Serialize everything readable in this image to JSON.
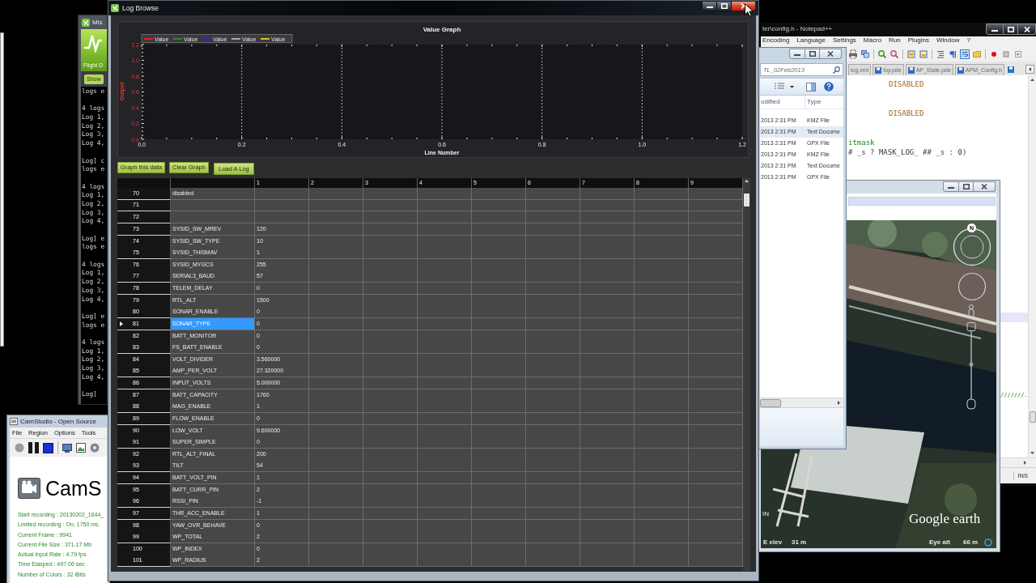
{
  "mission_planner": {
    "title": "Mis",
    "view_label": "Flight D",
    "show_button": "Show",
    "console_blocks": [
      [
        "logs e"
      ],
      [
        "4 logs",
        "Log 1,",
        "Log 2,",
        "Log 3,",
        "Log 4,"
      ],
      [
        "Log] c",
        "logs e"
      ],
      [
        "4 logs",
        "Log 1,",
        "Log 2,",
        "Log 3,",
        "Log 4,"
      ],
      [
        "Log] e",
        "logs e"
      ],
      [
        "4 logs",
        "Log 1,",
        "Log 2,",
        "Log 3,",
        "Log 4,"
      ],
      [
        "Log] e",
        "logs e"
      ],
      [
        "4 logs",
        "Log 1,",
        "Log 2,",
        "Log 3,",
        "Log 4,"
      ],
      [
        "Log]"
      ]
    ]
  },
  "camstudio": {
    "title": "CamStudio - Open Source",
    "menu": [
      "File",
      "Region",
      "Options",
      "Tools"
    ],
    "app_name": "CamS",
    "stats": [
      "Start recording : 20130202_1644_",
      "Limited recording : On, 1750 ms.",
      "Current Frame : 9941",
      "Current File Size : 371.17 Mb",
      "Actual Input Rate : 4.79 fps",
      "Time Elasped : 497.06 sec",
      "Number of Colors : 32 iBits"
    ]
  },
  "log_browse": {
    "title": "Log Browse",
    "graph": {
      "title": "Value Graph",
      "legend": [
        {
          "label": "Value",
          "color": "#e02424"
        },
        {
          "label": "Value",
          "color": "#2e8b2e"
        },
        {
          "label": "Value",
          "color": "#2424e0"
        },
        {
          "label": "Value",
          "color": "#a8a8a8"
        },
        {
          "label": "Value",
          "color": "#d4c21e"
        }
      ],
      "ylabel": "Output",
      "y_ticks": [
        "1.2",
        "1.0",
        "0.8",
        "0.6",
        "0.4",
        "0.2",
        "0.0"
      ],
      "x_ticks": [
        "0.0",
        "0.2",
        "0.4",
        "0.6",
        "0.8",
        "1.0",
        "1.2"
      ],
      "xlabel": "Line Number"
    },
    "buttons": [
      "Graph this data",
      "Clear Graph",
      "Load A Log"
    ],
    "table": {
      "columns": [
        "1",
        "2",
        "3",
        "4",
        "5",
        "6",
        "7",
        "8",
        "9"
      ],
      "rows": [
        {
          "row_header": "70",
          "column_0": "disabled",
          "selected": false
        },
        {
          "row_header": "71",
          "selected": false
        },
        {
          "row_header": "72",
          "selected": false
        },
        {
          "row_header": "73",
          "column_0": "SYSID_SW_MREV",
          "column_1": "120",
          "selected": false
        },
        {
          "row_header": "74",
          "column_0": "SYSID_SW_TYPE",
          "column_1": "10",
          "selected": false
        },
        {
          "row_header": "75",
          "column_0": "SYSID_THISMAV",
          "column_1": "1",
          "selected": false
        },
        {
          "row_header": "76",
          "column_0": "SYSID_MYGCS",
          "column_1": "255",
          "selected": false
        },
        {
          "row_header": "77",
          "column_0": "SERIAL3_BAUD",
          "column_1": "57",
          "selected": false
        },
        {
          "row_header": "78",
          "column_0": "TELEM_DELAY",
          "column_1": "0",
          "selected": false
        },
        {
          "row_header": "79",
          "column_0": "RTL_ALT",
          "column_1": "1500",
          "selected": false
        },
        {
          "row_header": "80",
          "column_0": "SONAR_ENABLE",
          "column_1": "0",
          "selected": false
        },
        {
          "row_header": "81",
          "column_0": "SONAR_TYPE",
          "column_1": "0",
          "selected": true
        },
        {
          "row_header": "82",
          "column_0": "BATT_MONITOR",
          "column_1": "0",
          "selected": false
        },
        {
          "row_header": "83",
          "column_0": "FS_BATT_ENABLE",
          "column_1": "0",
          "selected": false
        },
        {
          "row_header": "84",
          "column_0": "VOLT_DIVIDER",
          "column_1": "3.560000",
          "selected": false
        },
        {
          "row_header": "85",
          "column_0": "AMP_PER_VOLT",
          "column_1": "27.320000",
          "selected": false
        },
        {
          "row_header": "86",
          "column_0": "INPUT_VOLTS",
          "column_1": "5.000000",
          "selected": false
        },
        {
          "row_header": "87",
          "column_0": "BATT_CAPACITY",
          "column_1": "1760",
          "selected": false
        },
        {
          "row_header": "88",
          "column_0": "MAG_ENABLE",
          "column_1": "1",
          "selected": false
        },
        {
          "row_header": "89",
          "column_0": "FLOW_ENABLE",
          "column_1": "0",
          "selected": false
        },
        {
          "row_header": "90",
          "column_0": "LOW_VOLT",
          "column_1": "9.600000",
          "selected": false
        },
        {
          "row_header": "91",
          "column_0": "SUPER_SIMPLE",
          "column_1": "0",
          "selected": false
        },
        {
          "row_header": "92",
          "column_0": "RTL_ALT_FINAL",
          "column_1": "200",
          "selected": false
        },
        {
          "row_header": "93",
          "column_0": "TILT",
          "column_1": "54",
          "selected": false
        },
        {
          "row_header": "94",
          "column_0": "BATT_VOLT_PIN",
          "column_1": "1",
          "selected": false
        },
        {
          "row_header": "95",
          "column_0": "BATT_CURR_PIN",
          "column_1": "2",
          "selected": false
        },
        {
          "row_header": "96",
          "column_0": "RSSI_PIN",
          "column_1": "-1",
          "selected": false
        },
        {
          "row_header": "97",
          "column_0": "THR_ACC_ENABLE",
          "column_1": "1",
          "selected": false
        },
        {
          "row_header": "98",
          "column_0": "YAW_OVR_BEHAVE",
          "column_1": "0",
          "selected": false
        },
        {
          "row_header": "99",
          "column_0": "WP_TOTAL",
          "column_1": "2",
          "selected": false
        },
        {
          "row_header": "100",
          "column_0": "WP_INDEX",
          "column_1": "0",
          "selected": false
        },
        {
          "row_header": "101",
          "column_0": "WP_RADIUS",
          "column_1": "2",
          "selected": false
        }
      ]
    }
  },
  "notepad": {
    "title": "ter\\config.h - Notepad++",
    "menu": [
      "Encoding",
      "Language",
      "Settings",
      "Macro",
      "Run",
      "Plugins",
      "Window",
      "?"
    ],
    "toolbar_buttons": [
      {
        "pressed": false
      },
      {
        "pressed": false
      },
      {
        "pressed": false
      },
      {
        "pressed": false
      },
      {
        "pressed": false
      },
      {
        "pressed": false
      },
      {
        "pressed": false
      },
      {
        "pressed": false
      },
      {
        "pressed": true
      },
      {
        "pressed": false
      },
      {
        "pressed": false
      },
      {
        "pressed": false
      },
      {
        "pressed": false
      }
    ],
    "tabs": [
      {
        "label": "log.xml",
        "selected": false
      },
      {
        "label": "toy.pde",
        "selected": false
      },
      {
        "label": "AP_State.pde",
        "selected": false
      },
      {
        "label": "APM_Config.h",
        "selected": false
      }
    ],
    "code_lines": [
      {
        "text": "DISABLED",
        "kind": "constant"
      },
      {
        "text": "DISABLED",
        "kind": "constant"
      },
      {
        "text": "itmask",
        "kind": "comment"
      },
      {
        "text": "# _s ? MASK_LOG_ ## _s : 0)",
        "kind": "code"
      },
      {
        "text": "///////.",
        "kind": "comment"
      }
    ],
    "status": "INS"
  },
  "explorer": {
    "search": {
      "placeholder": "TL_02Feb2013"
    },
    "columns": [
      "odified",
      "Type"
    ],
    "files": [
      {
        "modified": "2013 2:31 PM",
        "type": "KMZ File",
        "selected": false
      },
      {
        "modified": "2013 2:31 PM",
        "type": "Text Docume",
        "selected": true
      },
      {
        "modified": "2013 2:31 PM",
        "type": "GPX File",
        "selected": false
      },
      {
        "modified": "2013 2:31 PM",
        "type": "KMZ File",
        "selected": false
      },
      {
        "modified": "2013 2:31 PM",
        "type": "Text Docume",
        "selected": false
      },
      {
        "modified": "2013 2:31 PM",
        "type": "GPX File",
        "selected": false
      }
    ]
  },
  "google_earth": {
    "north_label": "N",
    "side_label": "IN",
    "logo": "Google earth",
    "elevation_label": "E elev",
    "elevation": "31 m",
    "eye_alt_label": "Eye alt",
    "eye_alt": "66 m"
  }
}
